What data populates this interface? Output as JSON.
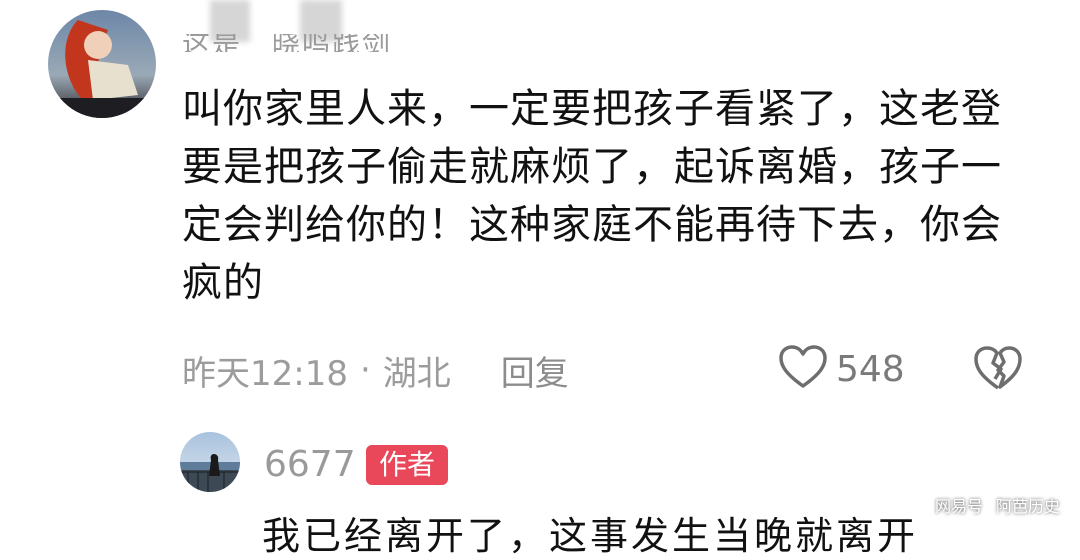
{
  "comment": {
    "username": "这是　晓鸣践剑",
    "text": "叫你家里人来，一定要把孩子看紧了，这老登要是把孩子偷走就麻烦了，起诉离婚，孩子一定会判给你的！这种家庭不能再待下去，你会疯的",
    "time": "昨天12:18",
    "separator": "·",
    "location": "湖北",
    "reply_label": "回复",
    "like_count": "548",
    "like_icon": "heart-icon",
    "dislike_icon": "broken-heart-icon"
  },
  "reply": {
    "username": "6677",
    "badge": "作者",
    "text": "我已经离开了，这事发生当晚就离开"
  },
  "watermark": {
    "left": "网易号",
    "right": "阿芭历史"
  },
  "colors": {
    "badge_bg": "#e9475a",
    "meta_gray": "#9c9c9c",
    "text": "#111111"
  }
}
